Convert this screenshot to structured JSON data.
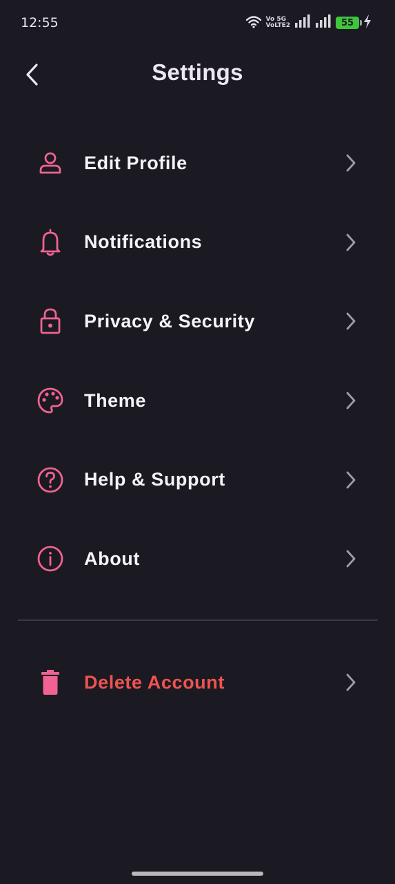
{
  "status_bar": {
    "time": "12:55",
    "network_top": "Vo 5G",
    "network_bottom": "VoLTE2",
    "battery": "55"
  },
  "header": {
    "title": "Settings",
    "back_icon": "chevron-left-icon"
  },
  "menu": {
    "items": [
      {
        "label": "Edit Profile",
        "icon": "person-icon"
      },
      {
        "label": "Notifications",
        "icon": "bell-icon"
      },
      {
        "label": "Privacy & Security",
        "icon": "lock-icon"
      },
      {
        "label": "Theme",
        "icon": "palette-icon"
      },
      {
        "label": "Help & Support",
        "icon": "help-circle-icon"
      },
      {
        "label": "About",
        "icon": "info-circle-icon"
      }
    ],
    "danger_item": {
      "label": "Delete Account",
      "icon": "trash-icon"
    }
  },
  "colors": {
    "background": "#1b1a22",
    "accent": "#f06292",
    "danger": "#ef5350",
    "chevron": "#9e9da5"
  }
}
